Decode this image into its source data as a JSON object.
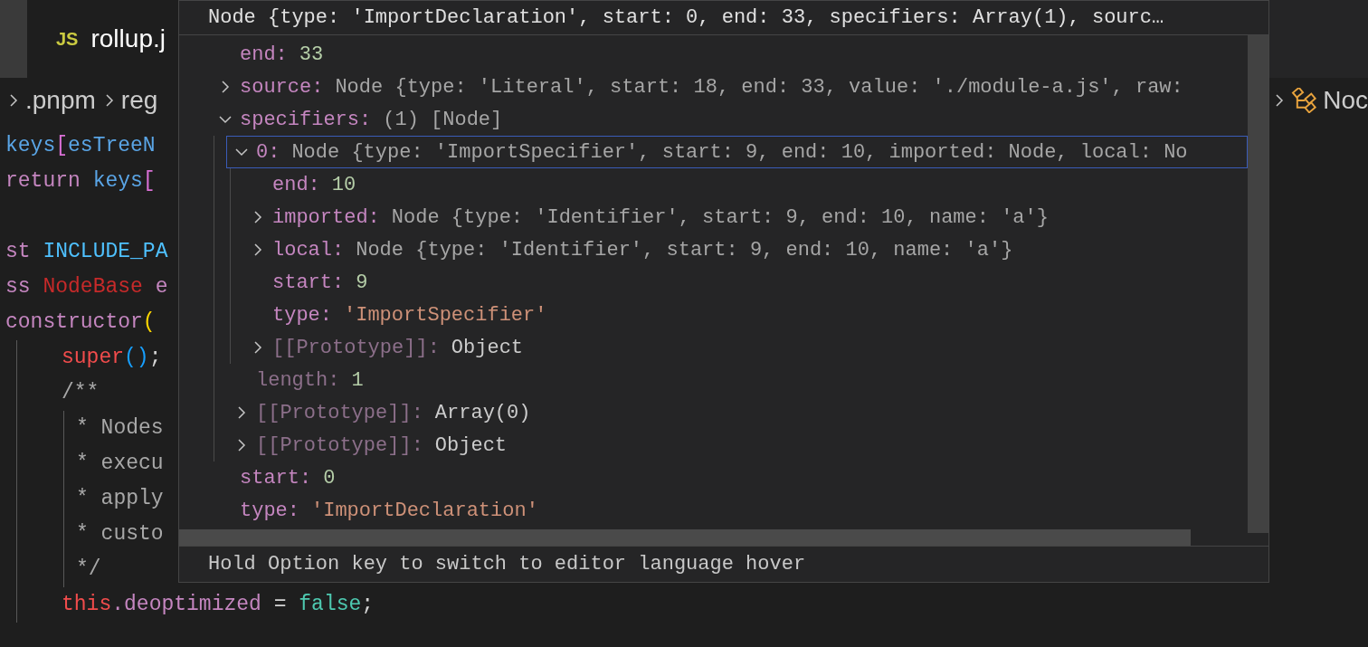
{
  "tab": {
    "icon_label": "JS",
    "title": "rollup.j"
  },
  "breadcrumb": {
    "items": [
      ".pnpm",
      "reg"
    ],
    "tail": "Noc"
  },
  "code_lines": [
    {
      "kind": "code",
      "tokens": [
        {
          "text": "keys",
          "kind": "variable"
        },
        {
          "text": "[",
          "kind": "bracket"
        },
        {
          "text": "esTreeN",
          "kind": "variable"
        }
      ]
    },
    {
      "kind": "code",
      "tokens": [
        {
          "text": "return ",
          "kind": "keyword"
        },
        {
          "text": "keys",
          "kind": "variable"
        },
        {
          "text": "[",
          "kind": "bracket"
        }
      ]
    },
    {
      "kind": "blank"
    },
    {
      "kind": "code",
      "tokens": [
        {
          "text": "st ",
          "kind": "keyword"
        },
        {
          "text": "INCLUDE_PA",
          "kind": "constant"
        }
      ]
    },
    {
      "kind": "code",
      "tokens": [
        {
          "text": "ss ",
          "kind": "keyword"
        },
        {
          "text": "NodeBase ",
          "kind": "class"
        },
        {
          "text": "e",
          "kind": "keyword"
        }
      ]
    },
    {
      "kind": "code",
      "tokens": [
        {
          "text": "constructor",
          "kind": "keyword"
        },
        {
          "text": "(",
          "kind": "paren"
        }
      ],
      "children": [
        {
          "kind": "code",
          "tokens": [
            {
              "text": "super",
              "kind": "special"
            },
            {
              "text": "()",
              "kind": "call"
            },
            {
              "text": ";",
              "kind": "plain"
            }
          ]
        },
        {
          "kind": "code",
          "tokens": [
            {
              "text": "/**",
              "kind": "comment"
            }
          ],
          "children": [
            {
              "kind": "code",
              "tokens": [
                {
                  "text": "* Nodes",
                  "kind": "comment"
                }
              ]
            },
            {
              "kind": "code",
              "tokens": [
                {
                  "text": "* execu",
                  "kind": "comment"
                }
              ]
            },
            {
              "kind": "code",
              "tokens": [
                {
                  "text": "* apply",
                  "kind": "comment"
                }
              ]
            },
            {
              "kind": "code",
              "tokens": [
                {
                  "text": "* custo",
                  "kind": "comment"
                }
              ]
            },
            {
              "kind": "code",
              "tokens": [
                {
                  "text": "*/",
                  "kind": "comment"
                }
              ]
            }
          ]
        },
        {
          "kind": "code",
          "tokens": [
            {
              "text": "this",
              "kind": "special"
            },
            {
              "text": ".deoptimized",
              "kind": "keyword"
            },
            {
              "text": " = ",
              "kind": "plain"
            },
            {
              "text": "false",
              "kind": "boolean"
            },
            {
              "text": ";",
              "kind": "plain"
            }
          ]
        }
      ]
    }
  ],
  "hover": {
    "header": "Node {type: 'ImportDeclaration', start: 0, end: 33, specifiers: Array(1), sourc…",
    "rows": [
      {
        "key": "end:",
        "value": "33",
        "kind": "number",
        "dim": false,
        "selected": false
      },
      {
        "key": "source:",
        "value": "Node {type: 'Literal', start: 18, end: 33, value: './module-a.js', raw:",
        "kind": "preview",
        "dim": false,
        "expanded": false,
        "selected": false
      },
      {
        "key": "specifiers:",
        "value": "(1) [Node]",
        "kind": "preview",
        "dim": false,
        "expanded": true,
        "selected": false,
        "children": [
          {
            "key": "0:",
            "value": "Node {type: 'ImportSpecifier', start: 9, end: 10, imported: Node, local: No",
            "kind": "preview",
            "dim": false,
            "expanded": true,
            "selected": true,
            "children": [
              {
                "key": "end:",
                "value": "10",
                "kind": "number",
                "dim": false,
                "selected": false
              },
              {
                "key": "imported:",
                "value": "Node {type: 'Identifier', start: 9, end: 10, name: 'a'}",
                "kind": "preview",
                "dim": false,
                "expanded": false,
                "selected": false
              },
              {
                "key": "local:",
                "value": "Node {type: 'Identifier', start: 9, end: 10, name: 'a'}",
                "kind": "preview",
                "dim": false,
                "expanded": false,
                "selected": false
              },
              {
                "key": "start:",
                "value": "9",
                "kind": "number",
                "dim": false,
                "selected": false
              },
              {
                "key": "type:",
                "value": "'ImportSpecifier'",
                "kind": "string",
                "dim": false,
                "selected": false
              },
              {
                "key": "[[Prototype]]:",
                "value": "Object",
                "kind": "plain",
                "dim": true,
                "expanded": false,
                "selected": false
              }
            ]
          },
          {
            "key": "length:",
            "value": "1",
            "kind": "number",
            "dim": true,
            "selected": false
          },
          {
            "key": "[[Prototype]]:",
            "value": "Array(0)",
            "kind": "plain",
            "dim": true,
            "expanded": false,
            "selected": false
          },
          {
            "key": "[[Prototype]]:",
            "value": "Object",
            "kind": "plain",
            "dim": true,
            "expanded": false,
            "selected": false
          }
        ]
      },
      {
        "key": "start:",
        "value": "0",
        "kind": "number",
        "dim": false,
        "selected": false
      },
      {
        "key": "type:",
        "value": "'ImportDeclaration'",
        "kind": "string",
        "dim": false,
        "selected": false
      }
    ],
    "footer": "Hold Option key to switch to editor language hover"
  }
}
